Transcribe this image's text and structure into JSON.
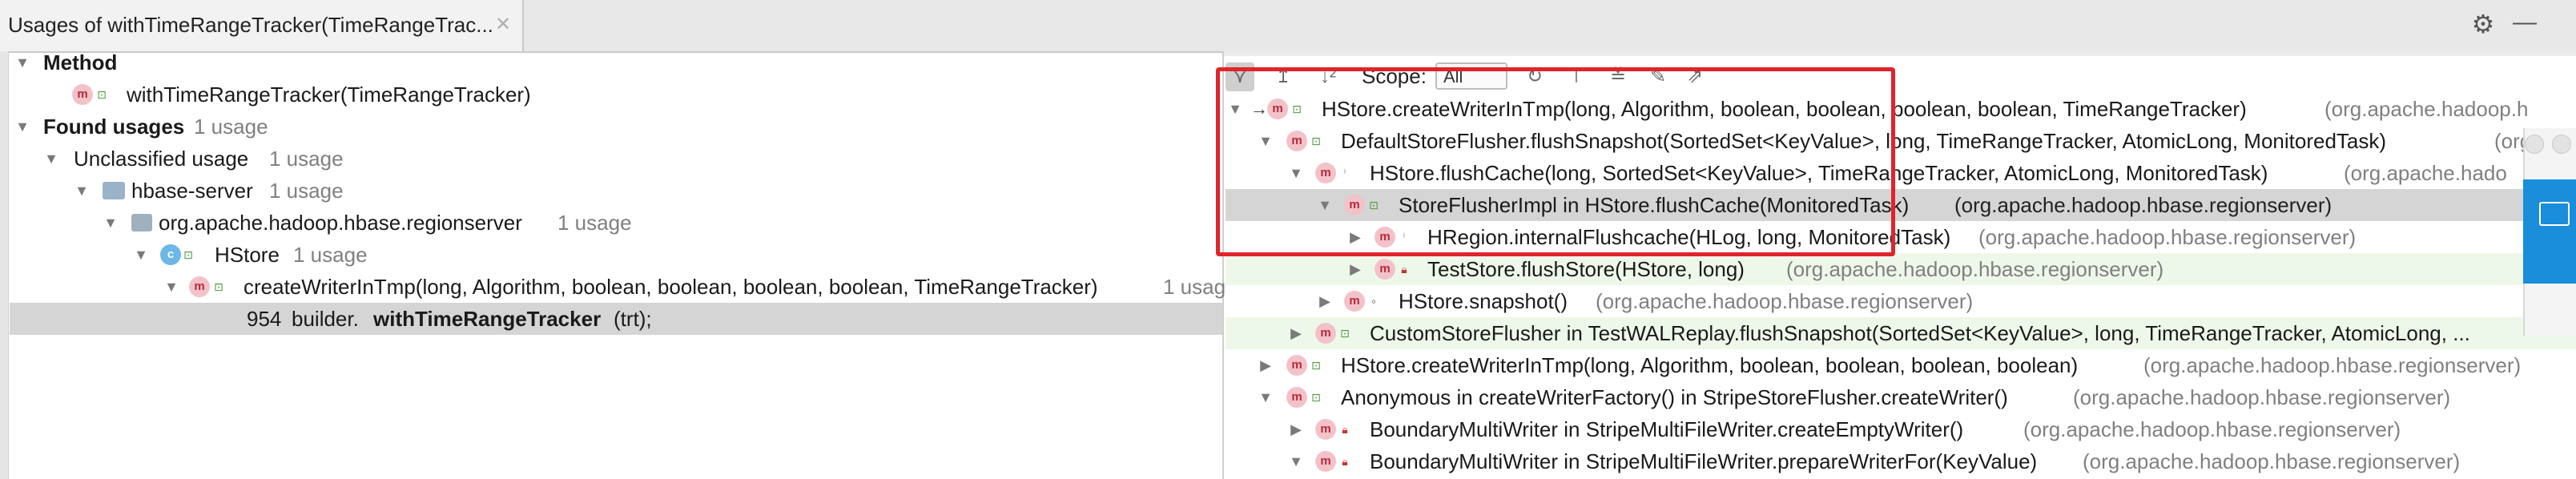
{
  "tab": {
    "title": "Usages of withTimeRangeTracker(TimeRangeTrac...",
    "close_icon": "close-icon"
  },
  "toolbar_right": {
    "gear_icon": "gear-icon",
    "minimize_icon": "minimize-icon",
    "minimize_glyph": "—"
  },
  "left_tree": {
    "method_heading": "Method",
    "method_name": "withTimeRangeTracker(TimeRangeTracker)",
    "found_usages": "Found usages",
    "found_usages_count": "1 usage",
    "unclassified": "Unclassified usage",
    "unclassified_count": "1 usage",
    "module": "hbase-server",
    "module_count": "1 usage",
    "package": "org.apache.hadoop.hbase.regionserver",
    "package_count": "1 usage",
    "class_name": "HStore",
    "class_count": "1 usage",
    "caller": "createWriterInTmp(long, Algorithm, boolean, boolean, boolean, boolean, TimeRangeTracker)",
    "caller_count": "1 usag",
    "line_number": "954",
    "line_prefix": "builder.",
    "line_bold": "withTimeRangeTracker",
    "line_suffix": "(trt);"
  },
  "call_hierarchy": {
    "scope_label": "Scope:",
    "scope_value": "All",
    "rows": [
      {
        "text": "HStore.createWriterInTmp(long, Algorithm, boolean, boolean, boolean, boolean, TimeRangeTracker)",
        "pkg": "(org.apache.hadoop.h"
      },
      {
        "text": "DefaultStoreFlusher.flushSnapshot(SortedSet<KeyValue>, long, TimeRangeTracker, AtomicLong, MonitoredTask)",
        "pkg": "(org"
      },
      {
        "text": "HStore.flushCache(long, SortedSet<KeyValue>, TimeRangeTracker, AtomicLong, MonitoredTask)",
        "pkg": "(org.apache.hado"
      },
      {
        "text": "StoreFlusherImpl in HStore.flushCache(MonitoredTask)",
        "pkg": "(org.apache.hadoop.hbase.regionserver)"
      },
      {
        "text": "HRegion.internalFlushcache(HLog, long, MonitoredTask)",
        "pkg": "(org.apache.hadoop.hbase.regionserver)"
      },
      {
        "text": "TestStore.flushStore(HStore, long)",
        "pkg": "(org.apache.hadoop.hbase.regionserver)"
      },
      {
        "text": "HStore.snapshot()",
        "pkg": "(org.apache.hadoop.hbase.regionserver)"
      },
      {
        "text": "CustomStoreFlusher in TestWALReplay.flushSnapshot(SortedSet<KeyValue>, long, TimeRangeTracker, AtomicLong, ...",
        "pkg": ""
      },
      {
        "text": "HStore.createWriterInTmp(long, Algorithm, boolean, boolean, boolean, boolean)",
        "pkg": "(org.apache.hadoop.hbase.regionserver)"
      },
      {
        "text": "Anonymous in createWriterFactory() in StripeStoreFlusher.createWriter()",
        "pkg": "(org.apache.hadoop.hbase.regionserver)"
      },
      {
        "text": "BoundaryMultiWriter in StripeMultiFileWriter.createEmptyWriter()",
        "pkg": "(org.apache.hadoop.hbase.regionserver)"
      },
      {
        "text": "BoundaryMultiWriter in StripeMultiFileWriter.prepareWriterFor(KeyValue)",
        "pkg": "(org.apache.hadoop.hbase.regionserver)"
      }
    ]
  },
  "icons": {
    "method": "m",
    "class": "c",
    "expanded": "▼",
    "collapsed": "▶",
    "recursion_arrow": "→",
    "gear": "⚙",
    "close": "✕"
  },
  "colors": {
    "highlight_box": "#e0242a",
    "selected_row": "#d5d5d5",
    "test_row": "#eef8ea",
    "method_icon_bg": "#f3c2c8",
    "class_icon_bg": "#6bb7e8"
  }
}
